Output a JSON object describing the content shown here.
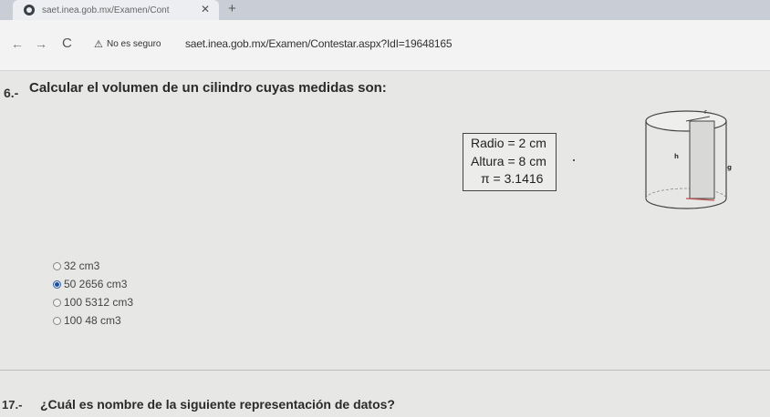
{
  "browser": {
    "tab_title": "saet.inea.gob.mx/Examen/Cont",
    "tab_close": "✕",
    "new_tab": "+",
    "back": "←",
    "forward": "→",
    "reload": "C",
    "warning_icon": "⚠",
    "security_label": "No es seguro",
    "url": "saet.inea.gob.mx/Examen/Contestar.aspx?IdI=19648165"
  },
  "question": {
    "number": "6.-",
    "text": "Calcular el volumen de un cilindro cuyas medidas son:",
    "data": {
      "radio": "Radio = 2 cm",
      "altura": "Altura = 8 cm",
      "pi": "π  = 3.1416"
    },
    "figure_labels": {
      "r": "r",
      "h": "h",
      "g": "g"
    },
    "options": [
      {
        "label": "32 cm3",
        "selected": false
      },
      {
        "label": "50 2656 cm3",
        "selected": true
      },
      {
        "label": "100 5312 cm3",
        "selected": false
      },
      {
        "label": "100 48 cm3",
        "selected": false
      }
    ]
  },
  "next_question": {
    "number": "17.-",
    "text": "¿Cuál es nombre de la siguiente representación de datos?"
  }
}
